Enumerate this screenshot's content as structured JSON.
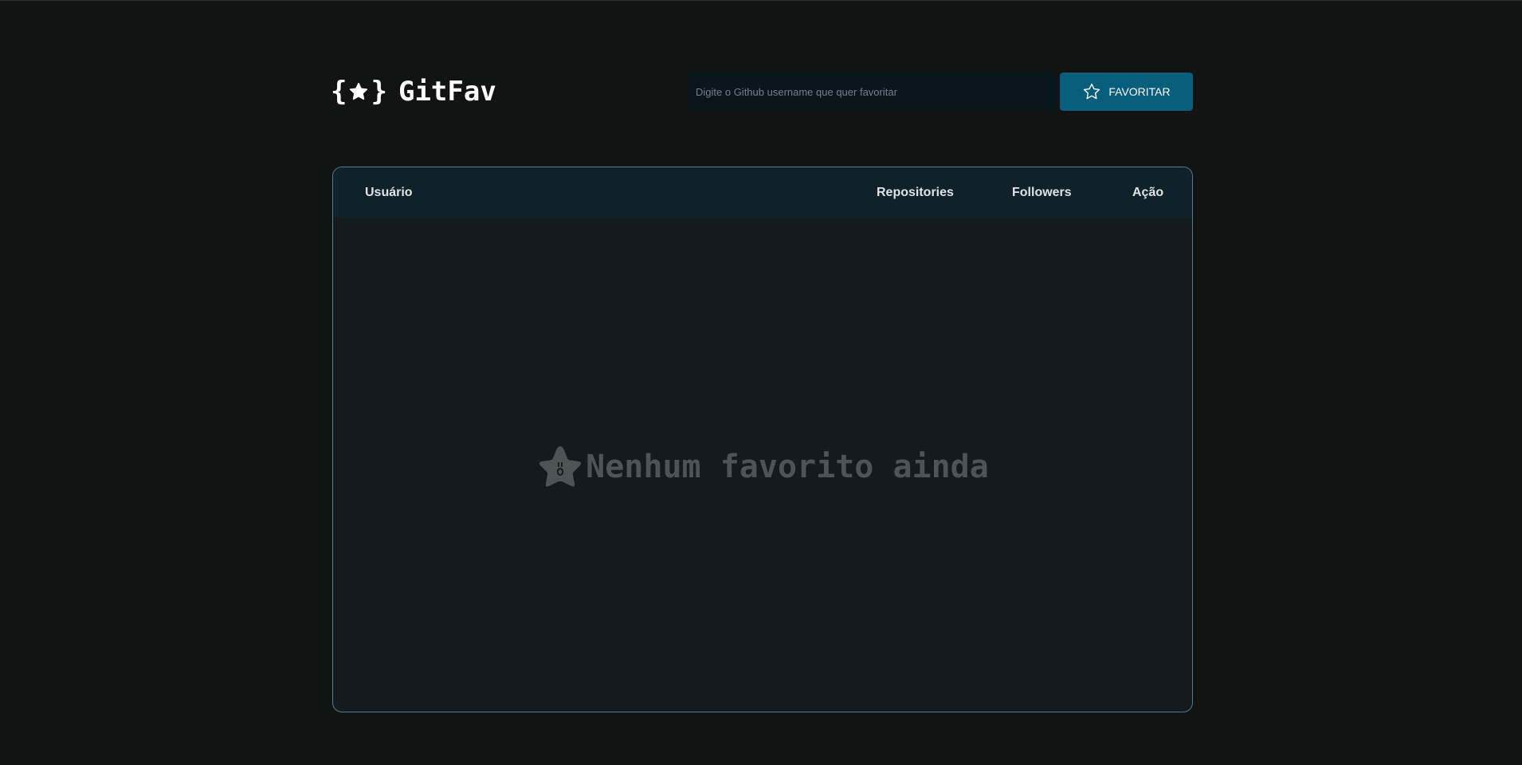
{
  "header": {
    "brace_open": "{",
    "brace_close": "}",
    "app_name": "GitFav",
    "logo_icon": "star-icon"
  },
  "search": {
    "placeholder": "Digite o Github username que quer favoritar",
    "value": ""
  },
  "favorite_button": {
    "label": "FAVORITAR",
    "icon": "star-outline-icon"
  },
  "table": {
    "columns": [
      "Usuário",
      "Repositories",
      "Followers",
      "Ação"
    ],
    "rows": []
  },
  "empty_state": {
    "message": "Nenhum favorito ainda",
    "icon": "surprised-star-icon"
  },
  "colors": {
    "background": "#121414",
    "accent": "#065e7c",
    "table_header": "#0f2129",
    "table_body": "#141a1d",
    "border": "#4a808c",
    "muted_text": "#4e5455"
  }
}
